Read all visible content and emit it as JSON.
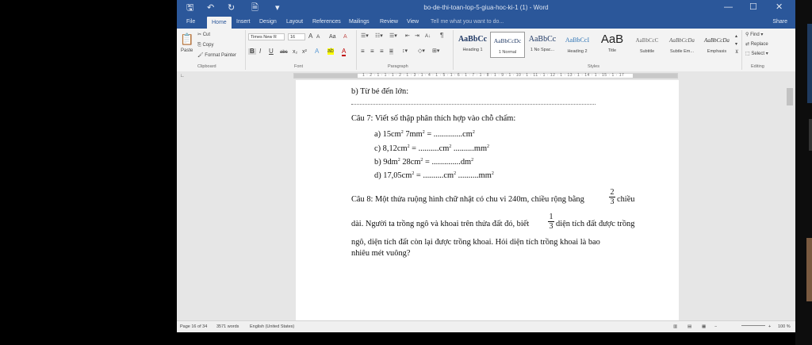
{
  "window": {
    "title": "bo-de-thi-toan-lop-5-giua-hoc-ki-1 (1) - Word",
    "tell_me": "Tell me what you want to do...",
    "share": "Share",
    "qat": {
      "save": "🖫",
      "undo": "↶",
      "redo": "↻",
      "print_preview": "🗎",
      "customize": "▾"
    },
    "minimize": "—",
    "maximize": "☐",
    "close": "✕"
  },
  "tabs": [
    "File",
    "Home",
    "Insert",
    "Design",
    "Layout",
    "References",
    "Mailings",
    "Review",
    "View"
  ],
  "ribbon": {
    "clipboard": {
      "paste": "Paste",
      "cut": "Cut",
      "copy": "Copy",
      "format_painter": "Format Painter",
      "group": "Clipboard"
    },
    "font": {
      "name": "Times New R",
      "size": "16",
      "grow": "A",
      "shrink": "A",
      "case": "Aa",
      "clear": "A",
      "bold": "B",
      "italic": "I",
      "underline": "U",
      "strike": "abc",
      "subscript": "x₂",
      "superscript": "x²",
      "effects": "A",
      "highlight": "ab",
      "color": "A",
      "group": "Font"
    },
    "paragraph": {
      "group": "Paragraph",
      "marks": "¶",
      "sort": "A↓"
    },
    "styles": {
      "items": [
        {
          "preview": "AaBbCc",
          "name": "Heading 1"
        },
        {
          "preview": "AaBbCcDc",
          "name": "1 Normal"
        },
        {
          "preview": "AaBbCc",
          "name": "1 No Spac..."
        },
        {
          "preview": "AaBbCcI",
          "name": "Heading 2"
        },
        {
          "preview": "AaB",
          "name": "Title"
        },
        {
          "preview": "AaBbCcC",
          "name": "Subtitle"
        },
        {
          "preview": "AaBbCcDa",
          "name": "Subtle Em..."
        },
        {
          "preview": "AaBbCcDa",
          "name": "Emphasis"
        }
      ],
      "group": "Styles"
    },
    "editing": {
      "find": "Find",
      "replace": "Replace",
      "select": "Select",
      "group": "Editing"
    }
  },
  "ruler": {
    "ticks": "1 · 2 · 1 · 1 · 1 · 2 · 1 · 3 · 1 · 4 · 1 · 5 · 1 · 6 · 1 · 7 · 1 · 8 · 1 · 9 · 1 · 10 · 1 · 11 · 1 · 12 · 1 · 13 · 1 · 14 · 1 · 15 · 1 · 17"
  },
  "document": {
    "b_line": "b) Từ bé đến lớn:",
    "cau7": "Câu 7: Viết số thập phân thích hợp vào chỗ chấm:",
    "items7": [
      {
        "label": "a) 15cm",
        "e1": "2",
        "t2": " 7mm",
        "e2": "2",
        "t3": " = ..............cm",
        "e3": "2",
        "t4": "",
        "e4": ""
      },
      {
        "label": "c) 8,12cm",
        "e1": "2",
        "t2": " = ..........cm",
        "e2": "2",
        "t3": " ..........mm",
        "e3": "2",
        "t4": "",
        "e4": ""
      },
      {
        "label": "b) 9dm",
        "e1": "2",
        "t2": " 28cm",
        "e2": "2",
        "t3": " = ..............dm",
        "e3": "2",
        "t4": "",
        "e4": ""
      },
      {
        "label": "d) 17,05cm",
        "e1": "2",
        "t2": " = ..........cm",
        "e2": "2",
        "t3": " ..........mm",
        "e3": "2",
        "t4": "",
        "e4": ""
      }
    ],
    "cau8_l1": "Câu 8: Một thửa ruộng hình chữ nhật có chu vi 240m, chiều rộng bằng",
    "frac1_num": "2",
    "frac1_den": "3",
    "cau8_l1_end": "chiều",
    "cau8_l2": "dài. Người ta trồng ngô và khoai trên thửa đất đó, biết",
    "frac2_num": "1",
    "frac2_den": "3",
    "cau8_l2_end": "diện tích đất được trồng",
    "cau8_l3": "ngô, diện tích đất còn lại được trồng khoai. Hỏi diện tích trồng khoai là bao",
    "cau8_l4": "nhiêu mét vuông?"
  },
  "status": {
    "page": "Page 16 of 34",
    "words": "3571 words",
    "language": "English (United States)",
    "zoom": "100 %",
    "zoom_out": "−",
    "zoom_in": "+"
  },
  "colors": {
    "title_bar": "#2b579a",
    "ribbon": "#f3f3f3",
    "workspace": "#e6e6e6"
  }
}
